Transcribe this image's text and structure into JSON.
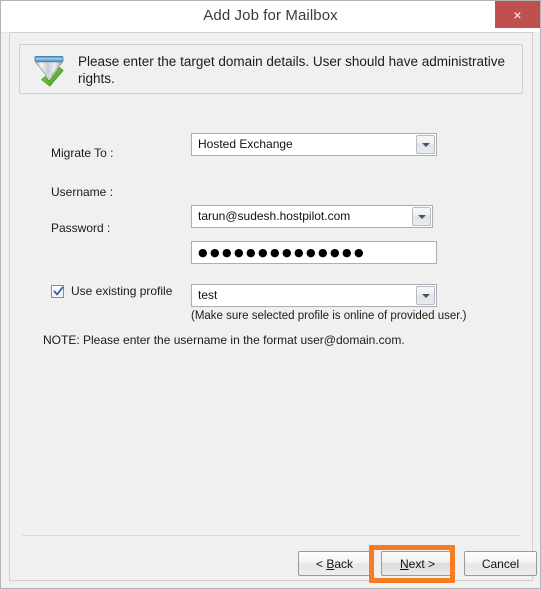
{
  "window": {
    "title": "Add Job for Mailbox",
    "close_icon": "close-icon",
    "close_glyph": "×",
    "close_color": "#c0504d"
  },
  "banner": {
    "icon": "funnel-check-icon",
    "message": "Please enter the target domain details. User should have administrative rights."
  },
  "form": {
    "migrate_to": {
      "label": "Migrate To :",
      "value": "Hosted Exchange",
      "dropdown_icon": "chevron-down-icon"
    },
    "username": {
      "label": "Username :",
      "value": "tarun@sudesh.hostpilot.com",
      "dropdown_icon": "chevron-down-icon"
    },
    "password": {
      "label": "Password :",
      "value": "●●●●●●●●●●●●●●",
      "masked": "true"
    },
    "use_existing_profile": {
      "label": "Use existing profile",
      "checked": "true",
      "check_icon": "checkmark-icon"
    },
    "profile": {
      "value": "test",
      "dropdown_icon": "chevron-down-icon"
    },
    "profile_hint": "(Make sure selected profile is online of provided user.)",
    "note": "NOTE: Please enter the username in the format user@domain.com."
  },
  "footer": {
    "back_label_prefix": "< ",
    "back_label_accel": "B",
    "back_label_suffix": "ack",
    "next_label_accel": "N",
    "next_label_suffix": "ext >",
    "cancel_label": "Cancel"
  },
  "annotation": {
    "highlight_color": "#f57c20",
    "highlight_target": "next-button"
  }
}
